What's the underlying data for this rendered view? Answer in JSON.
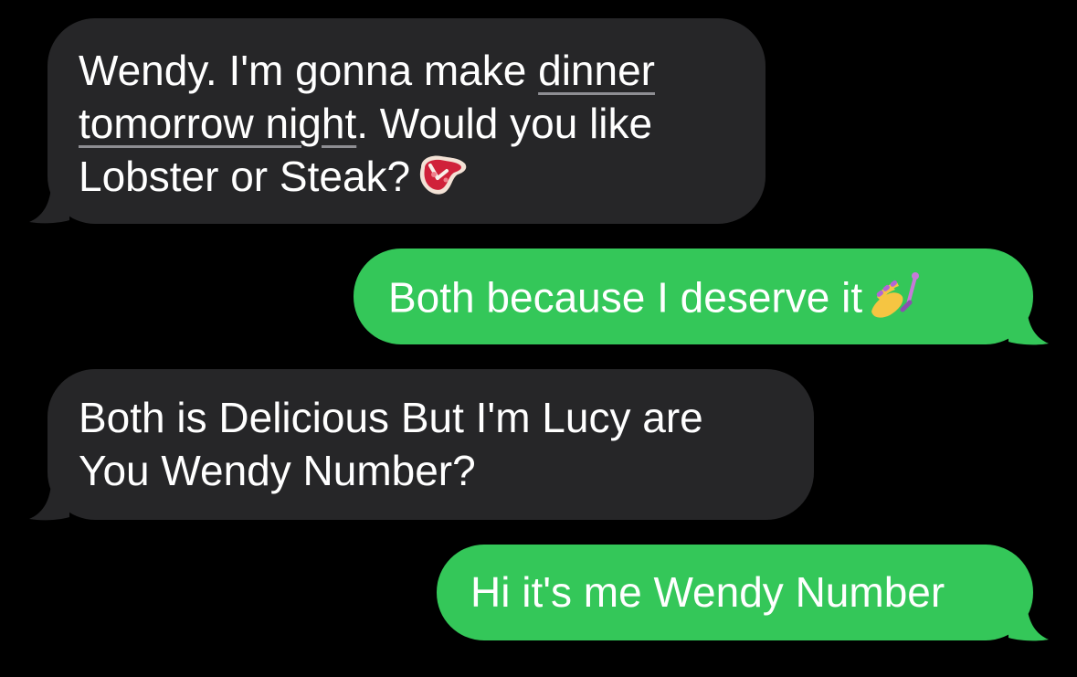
{
  "colors": {
    "background": "#000000",
    "incoming_bubble": "#262628",
    "outgoing_bubble": "#34c759",
    "text": "#ffffff",
    "link_underline": "#8e8e93"
  },
  "messages": [
    {
      "direction": "incoming",
      "line1_prefix": "Wendy. I'm gonna make ",
      "line1_link": "dinner",
      "line2_link": "tomorrow night",
      "line2_suffix": ". Would you like",
      "line3": "Lobster or Steak?",
      "emoji": "steak-emoji"
    },
    {
      "direction": "outgoing",
      "text": "Both because I deserve it",
      "emoji": "nail-polish-emoji"
    },
    {
      "direction": "incoming",
      "line1": "Both is Delicious But I'm Lucy are",
      "line2": "You Wendy Number?"
    },
    {
      "direction": "outgoing",
      "text": "Hi it's me Wendy Number"
    }
  ]
}
